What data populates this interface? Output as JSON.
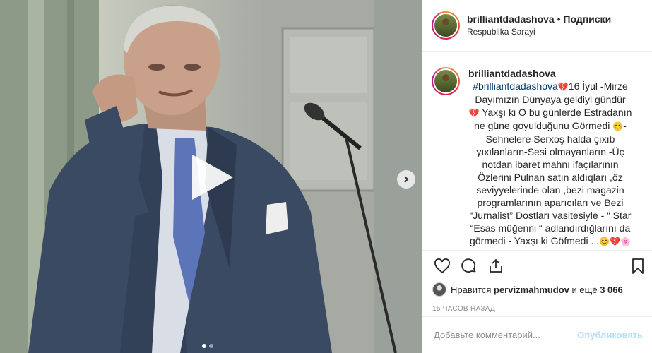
{
  "header": {
    "username": "brilliantdadashova",
    "separator": " • ",
    "follow_label": "Подписки",
    "location": "Respublika Sarayi"
  },
  "caption": {
    "username": "brilliantdadashova",
    "hashtag": "#brilliantdadashova",
    "line1": "16 İyul -Mirze Dayımızın Dünyaya geldiyi gündür",
    "line2": "Yaxşı ki O bu günlerde Estradanın ne güne goyulduğunu Görmedi",
    "line3": "-Sehnelere Serxoş halda çıxıb yıxılanların-Sesi olmayanların -Üç notdan ibaret mahnı ifaçılarının Özlerini Pulnan satın aldıqları ,öz seviyyelerinde olan ,bezi magazin programlarının aparıcıları ve Bezi “Jurnalist” Dostları vasitesiyle - “ Star “Esas müğenni “ adlandırdığlarını da görmedi - Yaxşı ki Göfmedi ...",
    "emoji_broken_heart": "💔",
    "emoji_smile": "😊",
    "emoji_flower": "🌸"
  },
  "likes": {
    "prefix": "Нравится ",
    "user": "pervizmahmudov",
    "middle": " и ещё ",
    "count": "3 066"
  },
  "timestamp": "15 ЧАСОВ НАЗАД",
  "comment": {
    "placeholder": "Добавьте комментарий...",
    "post_label": "Опубликовать"
  },
  "media": {
    "slide_current": 1,
    "slide_total": 2
  },
  "icons": {
    "like": "heart-icon",
    "comment": "comment-icon",
    "share": "share-icon",
    "save": "bookmark-icon",
    "play": "play-icon",
    "next": "chevron-right-icon"
  },
  "colors": {
    "hashtag": "#00376b",
    "post_button_disabled": "#b2dffc",
    "muted": "#8e8e8e",
    "border": "#efefef"
  }
}
